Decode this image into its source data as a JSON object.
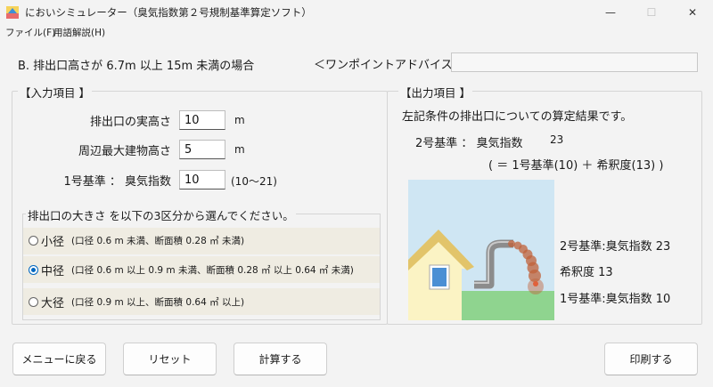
{
  "window": {
    "title": "においシミュレーター（臭気指数第２号規制基準算定ソフト）",
    "minimize_glyph": "—",
    "maximize_glyph": "☐",
    "close_glyph": "✕"
  },
  "menu": {
    "file": "ファイル(F)",
    "glossary": "用語解説(H)"
  },
  "header": {
    "case_title": "B. 排出口高さが 6.7m 以上 15m 未満の場合",
    "advice_label": "＜ワンポイントアドバイス＞",
    "advice_text": ""
  },
  "input": {
    "legend": "【入力項目 】",
    "outlet_height": {
      "label": "排出口の実高さ",
      "value": "10",
      "unit": "m"
    },
    "building_height": {
      "label": "周辺最大建物高さ",
      "value": "5",
      "unit": "m"
    },
    "standard1": {
      "label": "1号基準 ：  臭気指数",
      "value": "10",
      "unit": "(10〜21)"
    },
    "size": {
      "legend": "排出口の大きさ を以下の3区分から選んでください。",
      "options": [
        {
          "label": "小径",
          "desc": "(口径 0.6 m 未満、断面積 0.28 ㎡ 未満)",
          "checked": false
        },
        {
          "label": "中径",
          "desc": "(口径 0.6 m 以上 0.9 m 未満、断面積 0.28 ㎡ 以上 0.64 ㎡ 未満)",
          "checked": true
        },
        {
          "label": "大径",
          "desc": "(口径 0.9 m 以上、断面積 0.64 ㎡ 以上)",
          "checked": false
        }
      ]
    }
  },
  "output": {
    "legend": "【出力項目 】",
    "description": "左記条件の排出口についての算定結果です。",
    "standard2_label": "2号基準 ：  臭気指数",
    "standard2_value": "23",
    "formula": "( ＝ 1号基準(10) ＋ 希釈度(13) )",
    "legend_standard2": "2号基準:臭気指数 23",
    "legend_dilution": "希釈度 13",
    "legend_standard1": "1号基準:臭気指数 10"
  },
  "buttons": {
    "menu": "メニューに戻る",
    "reset": "リセット",
    "calculate": "計算する",
    "print": "印刷する"
  },
  "colors": {
    "accent": "#0067c0",
    "sky": "#cfe6f3",
    "grass": "#8fd48f",
    "house_wall": "#fbf3c4",
    "roof": "#e2c46a",
    "window": "#4a8fd4",
    "pipe": "#8c8c8c",
    "plume": "#c0623a",
    "option_band": "#efece2"
  }
}
